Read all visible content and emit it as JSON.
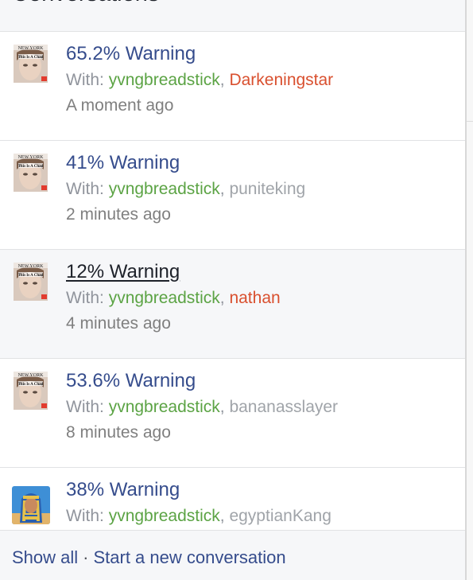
{
  "header": {
    "title": "Conversations"
  },
  "conversations": [
    {
      "title": "65.2% Warning",
      "with_label": "With:",
      "participants": [
        {
          "name": "yvngbreadstick",
          "color": "#5ba344"
        },
        {
          "name": "Darkeningstar",
          "color": "#d9502f"
        }
      ],
      "time": "A moment ago",
      "avatar": {
        "icon": "magazine-cover-avatar",
        "masthead": "NEW YORK",
        "tag": "This Is A Chad"
      }
    },
    {
      "title": "41% Warning",
      "with_label": "With:",
      "participants": [
        {
          "name": "yvngbreadstick",
          "color": "#5ba344"
        },
        {
          "name": "puniteking",
          "color": "#a0a4a9"
        }
      ],
      "time": "2 minutes ago",
      "avatar": {
        "icon": "magazine-cover-avatar",
        "masthead": "NEW YORK",
        "tag": "This Is A Chad"
      }
    },
    {
      "title": "12% Warning",
      "with_label": "With:",
      "participants": [
        {
          "name": "yvngbreadstick",
          "color": "#5ba344"
        },
        {
          "name": "nathan",
          "color": "#d9502f"
        }
      ],
      "time": "4 minutes ago",
      "avatar": {
        "icon": "magazine-cover-avatar",
        "masthead": "NEW YORK",
        "tag": "This Is A Chad"
      }
    },
    {
      "title": "53.6% Warning",
      "with_label": "With:",
      "participants": [
        {
          "name": "yvngbreadstick",
          "color": "#5ba344"
        },
        {
          "name": "bananasslayer",
          "color": "#a0a4a9"
        }
      ],
      "time": "8 minutes ago",
      "avatar": {
        "icon": "magazine-cover-avatar",
        "masthead": "NEW YORK",
        "tag": "This Is A Chad"
      }
    },
    {
      "title": "38% Warning",
      "with_label": "With:",
      "participants": [
        {
          "name": "yvngbreadstick",
          "color": "#5ba344"
        },
        {
          "name": "egyptianKang",
          "color": "#a0a4a9"
        }
      ],
      "avatar": {
        "icon": "pharaoh-avatar"
      }
    }
  ],
  "footer": {
    "show_all": "Show all",
    "separator": "·",
    "start_new": "Start a new conversation"
  },
  "colors": {
    "link": "#354c8c",
    "online_green": "#5ba344",
    "alert_red": "#d9502f",
    "muted_grey": "#a0a4a9"
  }
}
